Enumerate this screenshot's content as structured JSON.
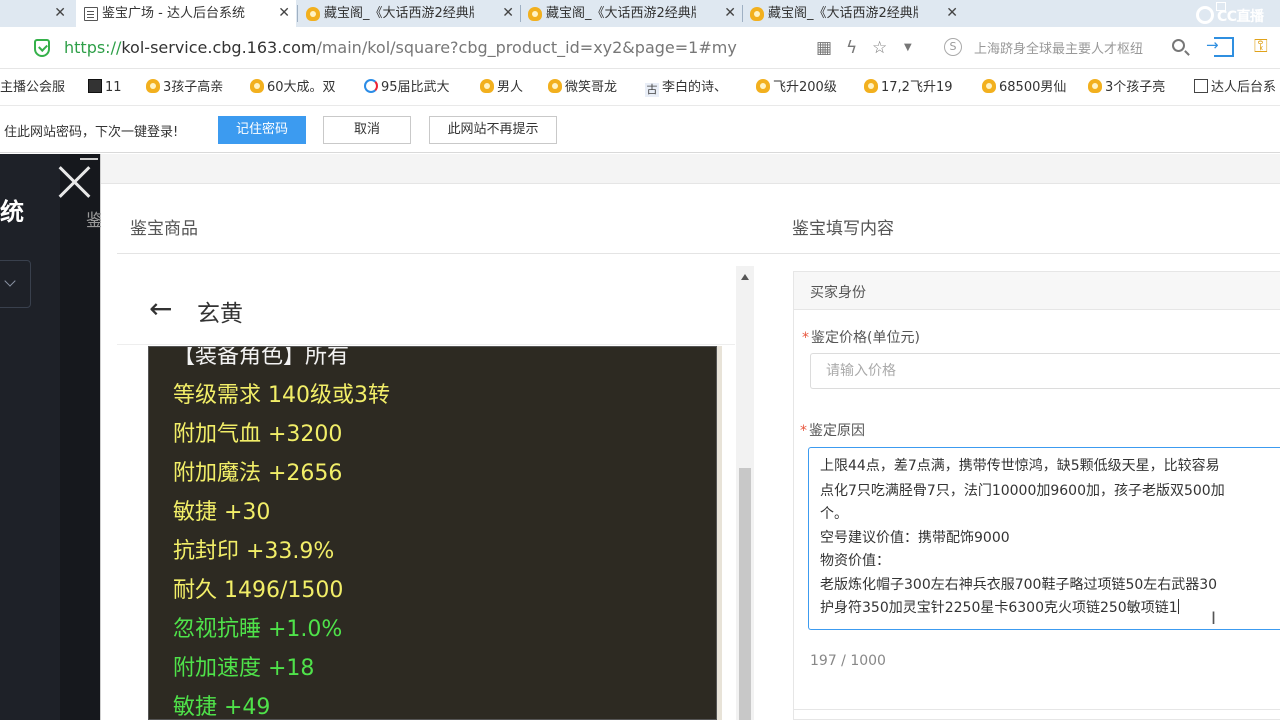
{
  "tabs": [
    {
      "title": "",
      "active": false
    },
    {
      "title": "鉴宝广场 - 达人后台系统",
      "active": true
    },
    {
      "title": "藏宝阁_《大话西游2经典版》",
      "active": false
    },
    {
      "title": "藏宝阁_《大话西游2经典版》",
      "active": false
    },
    {
      "title": "藏宝阁_《大话西游2经典版》",
      "active": false
    }
  ],
  "brand": {
    "label": "CC直播"
  },
  "address": {
    "protocol": "https://",
    "host": "kol-service.cbg.163.com",
    "path": "/main/kol/square?cbg_product_id=xy2&page=1#my",
    "search_text": "上海跻身全球最主要人才枢纽"
  },
  "bookmarks": [
    {
      "label": "主播公会服",
      "icon": "none"
    },
    {
      "label": "11",
      "icon": "dark-square-icon"
    },
    {
      "label": "3孩子高亲",
      "icon": "emblem-icon"
    },
    {
      "label": "60大成。双",
      "icon": "emblem-icon"
    },
    {
      "label": "95届比武大",
      "icon": "c-logo-icon"
    },
    {
      "label": "男人",
      "icon": "emblem-icon"
    },
    {
      "label": "微笑哥龙",
      "icon": "emblem-icon"
    },
    {
      "label": "李白的诗、",
      "icon": "gu-icon"
    },
    {
      "label": "飞升200级",
      "icon": "emblem-icon"
    },
    {
      "label": "17,2飞升19",
      "icon": "emblem-icon"
    },
    {
      "label": "68500男仙",
      "icon": "emblem-icon"
    },
    {
      "label": "3个孩子亮",
      "icon": "emblem-icon"
    },
    {
      "label": "达人后台系",
      "icon": "doc-icon"
    }
  ],
  "password_bar": {
    "message": "住此网站密码，下次一键登录!",
    "remember": "记住密码",
    "cancel": "取消",
    "never": "此网站不再提示"
  },
  "background": {
    "side_text": "统",
    "behind_text": "鉴"
  },
  "dialog": {
    "left_title": "鉴宝商品",
    "right_title": "鉴宝填写内容",
    "preview": {
      "title": "玄黄",
      "lines": [
        {
          "text": "【装备角色】所有",
          "color": "white"
        },
        {
          "text": "等级需求 140级或3转",
          "color": "yellow"
        },
        {
          "text": "附加气血 +3200",
          "color": "yellow"
        },
        {
          "text": "附加魔法 +2656",
          "color": "yellow"
        },
        {
          "text": "敏捷 +30",
          "color": "yellow"
        },
        {
          "text": "抗封印 +33.9%",
          "color": "yellow"
        },
        {
          "text": "耐久 1496/1500",
          "color": "yellow"
        },
        {
          "text": "忽视抗睡 +1.0%",
          "color": "green"
        },
        {
          "text": "附加速度 +18",
          "color": "green"
        },
        {
          "text": "敏捷 +49",
          "color": "green"
        }
      ]
    },
    "form": {
      "buyer_section": "买家身份",
      "price_label": "鉴定价格(单位元)",
      "price_placeholder": "请输入价格",
      "reason_label": "鉴定原因",
      "reason_lines": [
        "上限44点，差7点满，携带传世惊鸿，缺5颗低级天星，比较容易",
        "点化7只吃满胫骨7只，法门10000加9600加，孩子老版双500加",
        "个。",
        "空号建议价值：携带配饰9000",
        "物资价值：",
        "老版炼化帽子300左右神兵衣服700鞋子略过项链50左右武器30",
        "护身符350加灵宝针2250星卡6300克火项链250敏项链1"
      ],
      "char_count": "197 / 1000"
    }
  },
  "colors": {
    "accent": "#3c9bf0",
    "required": "#e8553c",
    "equip_bg": "#2d2a22",
    "equip_yellow": "#f2ee68",
    "equip_green": "#4fe24a",
    "ssl_green": "#2e9f48"
  }
}
